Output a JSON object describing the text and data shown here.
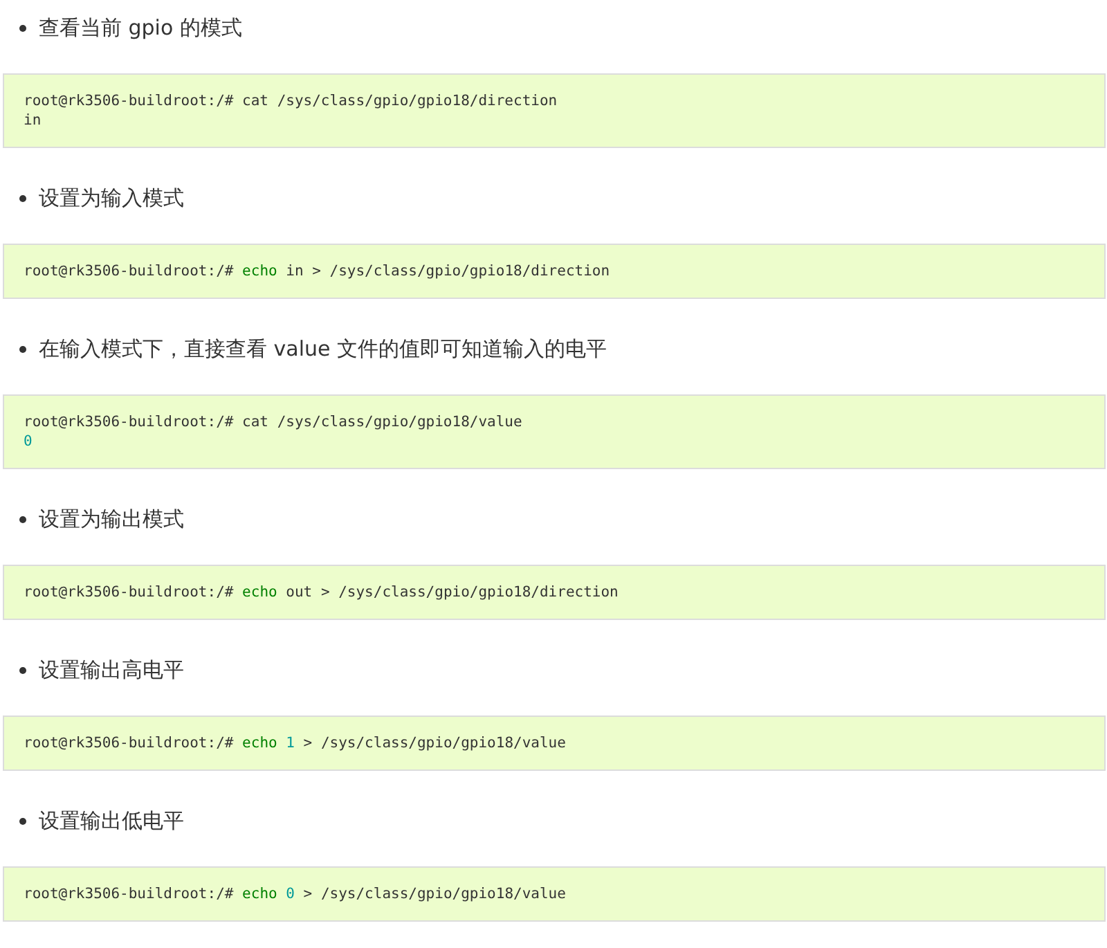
{
  "sections": [
    {
      "bullet": "查看当前 gpio 的模式",
      "code": [
        [
          {
            "text": "root@rk3506-buildroot:/# cat /sys/class/gpio/gpio18/direction",
            "kind": "plain"
          }
        ],
        [
          {
            "text": "in",
            "kind": "plain"
          }
        ]
      ]
    },
    {
      "bullet": "设置为输入模式",
      "code": [
        [
          {
            "text": "root@rk3506-buildroot:/# ",
            "kind": "plain"
          },
          {
            "text": "echo",
            "kind": "keyword"
          },
          {
            "text": " in > /sys/class/gpio/gpio18/direction",
            "kind": "plain"
          }
        ]
      ]
    },
    {
      "bullet": "在输入模式下，直接查看 value 文件的值即可知道输入的电平",
      "code": [
        [
          {
            "text": "root@rk3506-buildroot:/# cat /sys/class/gpio/gpio18/value",
            "kind": "plain"
          }
        ],
        [
          {
            "text": "0",
            "kind": "number"
          }
        ]
      ]
    },
    {
      "bullet": "设置为输出模式",
      "code": [
        [
          {
            "text": "root@rk3506-buildroot:/# ",
            "kind": "plain"
          },
          {
            "text": "echo",
            "kind": "keyword"
          },
          {
            "text": " out > /sys/class/gpio/gpio18/direction",
            "kind": "plain"
          }
        ]
      ]
    },
    {
      "bullet": "设置输出高电平",
      "code": [
        [
          {
            "text": "root@rk3506-buildroot:/# ",
            "kind": "plain"
          },
          {
            "text": "echo ",
            "kind": "keyword"
          },
          {
            "text": "1",
            "kind": "number"
          },
          {
            "text": " > /sys/class/gpio/gpio18/value",
            "kind": "plain"
          }
        ]
      ]
    },
    {
      "bullet": "设置输出低电平",
      "code": [
        [
          {
            "text": "root@rk3506-buildroot:/# ",
            "kind": "plain"
          },
          {
            "text": "echo ",
            "kind": "keyword"
          },
          {
            "text": "0",
            "kind": "number"
          },
          {
            "text": " > /sys/class/gpio/gpio18/value",
            "kind": "plain"
          }
        ]
      ]
    }
  ]
}
